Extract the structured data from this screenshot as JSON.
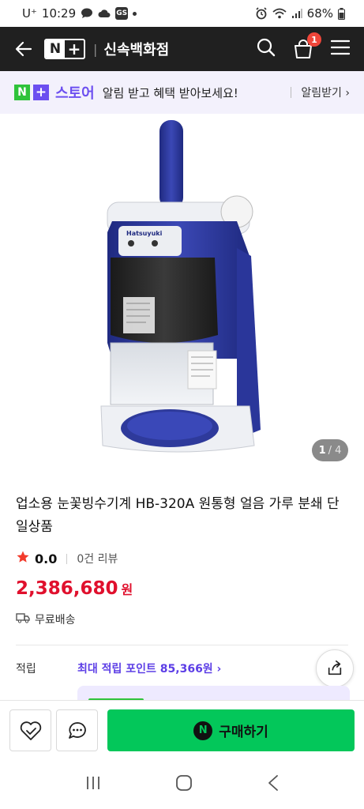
{
  "status_bar": {
    "carrier": "U⁺",
    "time": "10:29",
    "gs_badge": "GS",
    "battery": "68%"
  },
  "header": {
    "store_name": "신속백화점",
    "cart_count": "1",
    "brand_n": "N",
    "brand_plus": "+",
    "separator": "|"
  },
  "store_banner": {
    "logo_n": "N",
    "logo_plus": "+",
    "logo_text": "스토어",
    "message": "알림 받고 혜택 받아보세요!",
    "notify_label": "알림받기 ›"
  },
  "product": {
    "image_index": "1",
    "image_total": "/ 4",
    "image_brand_text": "Hatsuyuki",
    "title": "업소용 눈꽃빙수기계 HB-320A 원통형 얼음 가루 분쇄 단일상품",
    "rating": "0.0",
    "reviews": "0건 리뷰",
    "price": "2,386,680",
    "price_unit": "원",
    "shipping": "무료배송",
    "points_label": "적립",
    "points_value": "최대 적립 포인트 85,366원 ›"
  },
  "bottom_bar": {
    "buy_label": "구매하기",
    "npay_glyph": "N"
  },
  "colors": {
    "header_bg": "#202020",
    "price_red": "#e0102d",
    "points_purple": "#5c3ee6",
    "buy_green": "#03c75a",
    "machine_blue": "#2e3a9b"
  },
  "icons": [
    "back-arrow-icon",
    "search-icon",
    "cart-icon",
    "menu-icon",
    "star-icon",
    "truck-icon",
    "share-icon",
    "heart-icon",
    "talk-icon",
    "recent-apps-icon",
    "home-icon",
    "nav-back-icon"
  ]
}
